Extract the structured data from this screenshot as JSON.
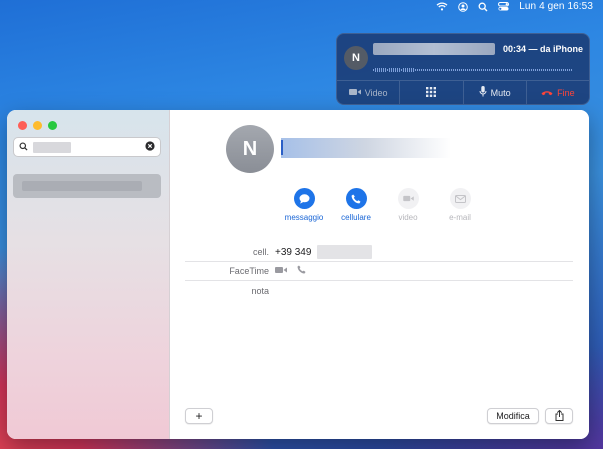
{
  "menubar": {
    "clock": "Lun 4 gen  16:53",
    "icons": [
      "wifi-icon",
      "user-icon",
      "search-icon",
      "control-center-icon"
    ]
  },
  "call": {
    "avatar_initial": "N",
    "status": "00:34 — da iPhone",
    "video_label": "Video",
    "keypad_icon": "keypad-icon",
    "mute_label": "Muto",
    "end_label": "Fine"
  },
  "window": {
    "avatar_initial": "N",
    "actions": [
      {
        "label": "messaggio",
        "icon": "message-icon",
        "enabled": true
      },
      {
        "label": "cellulare",
        "icon": "phone-icon",
        "enabled": true
      },
      {
        "label": "video",
        "icon": "video-icon",
        "enabled": false
      },
      {
        "label": "e-mail",
        "icon": "mail-icon",
        "enabled": false
      }
    ],
    "fields": {
      "cell_label": "cell.",
      "cell_value": "+39 349",
      "facetime_label": "FaceTime",
      "note_label": "nota"
    },
    "add_label": "+",
    "edit_label": "Modifica",
    "share_icon": "share-icon"
  },
  "colors": {
    "accent": "#1e74e8",
    "end_call": "#ff453a",
    "call_bg": "#1c3f7a"
  }
}
